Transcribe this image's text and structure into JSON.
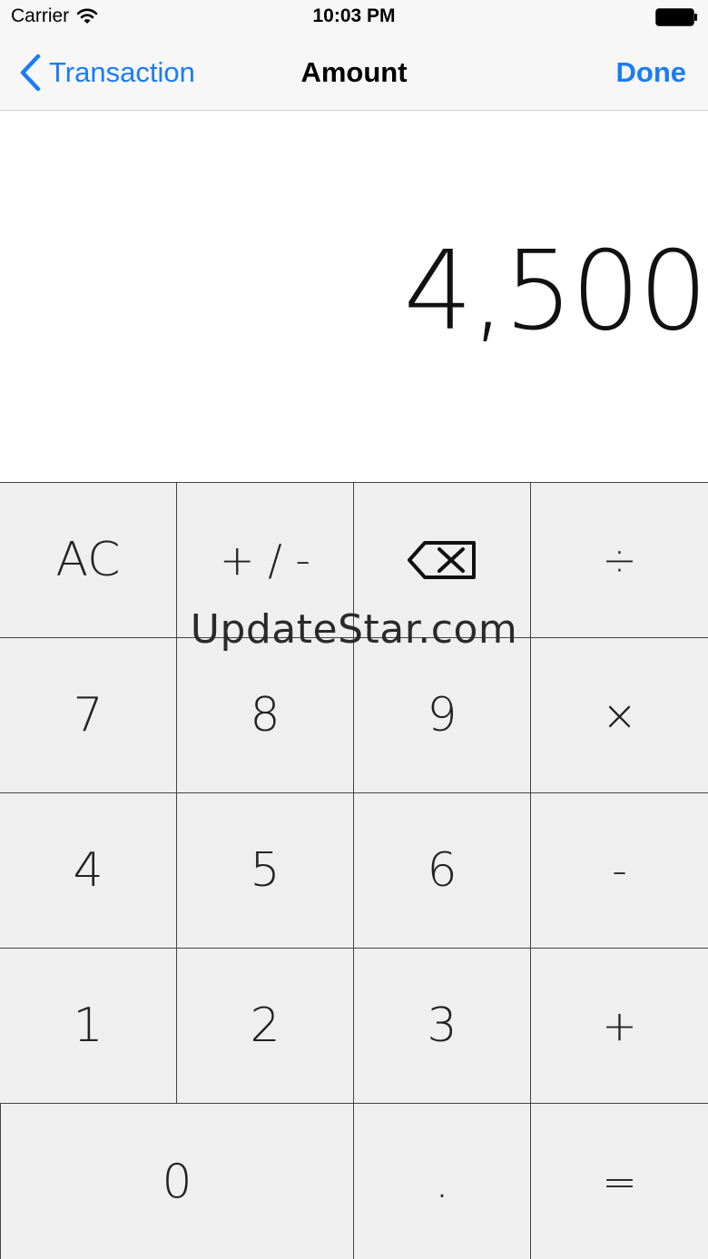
{
  "status_bar": {
    "carrier": "Carrier",
    "time": "10:03 PM",
    "wifi_icon": "wifi-icon",
    "battery_icon": "battery-icon"
  },
  "nav_bar": {
    "back_label": "Transaction",
    "title": "Amount",
    "done_label": "Done",
    "accent_color": "#1a7cf5"
  },
  "display": {
    "value": "4,500"
  },
  "keypad": {
    "rows": [
      [
        "AC",
        "+ / -",
        "backspace-icon",
        "÷"
      ],
      [
        "7",
        "8",
        "9",
        "×"
      ],
      [
        "4",
        "5",
        "6",
        "-"
      ],
      [
        "1",
        "2",
        "3",
        "+"
      ],
      [
        "0",
        ".",
        "="
      ]
    ],
    "ac": "AC",
    "plus_minus": "+ / -",
    "backspace": "backspace-icon",
    "divide": "÷",
    "seven": "7",
    "eight": "8",
    "nine": "9",
    "multiply": "×",
    "four": "4",
    "five": "5",
    "six": "6",
    "minus": "-",
    "one": "1",
    "two": "2",
    "three": "3",
    "plus": "+",
    "zero": "0",
    "decimal": ".",
    "equals": "="
  },
  "watermark": "UpdateStar.com"
}
